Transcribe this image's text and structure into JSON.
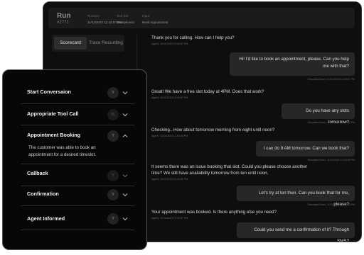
{
  "header": {
    "title": "Run",
    "run_id": "#2771",
    "fields": [
      {
        "label": "Runtime",
        "value": "11/11/2023 12:44:57 PM"
      },
      {
        "label": "Tool Set",
        "value": "Receptionist"
      },
      {
        "label": "Input",
        "value": "Book Appointment"
      }
    ]
  },
  "tabs": [
    {
      "label": "Scorecard",
      "active": true
    },
    {
      "label": "Trace Recording",
      "active": false
    }
  ],
  "transcript": {
    "agent": [
      {
        "text": "Thank you for calling. How can I help you?",
        "meta": "Agent | 11/11/2023 12:44:57 PM"
      },
      {
        "text": "Great! We have a free slot today at 4PM. Does that work?",
        "meta": "Agent | 11/11/2023 12:44:57 PM"
      },
      {
        "text": "Checking...How about tomorrow morning from eight until noon?",
        "meta": "Agent | 11/11/2023 12:44:44 PM"
      },
      {
        "text": "It seems there was an issue booking that slot. Could you please choose another time? We still have availability tomorrow from ten until noon.",
        "meta": "Agent | 11/11/2023 12:44:52 PM"
      },
      {
        "text": "Your appointment was booked. Is there anything else you need?",
        "meta": "Agent | 11/11/2023 12:44:57 PM"
      }
    ],
    "user": [
      {
        "text": "Hi! I'd like to book an appointment, please. Can you help me with that?",
        "meta": "Simulated User | 11/11/2023 12:44:57 PM"
      },
      {
        "text": "Do you have any slots tomorrow?",
        "meta": "Simulated User | 11/11/2023 12:44:12 PM"
      },
      {
        "text": "I can do 9 AM tomorrow. Can we book that?",
        "meta": "Simulated User | 11/11/2023 12:44:28 PM"
      },
      {
        "text": "Let's try at ten then. Can you book that for me, please?",
        "meta": "Simulated User | 11/11/2023 12:44:53 PM"
      },
      {
        "text": "Could you send me a confirmation of it? Through SMS?",
        "meta": ""
      }
    ]
  },
  "scorecard": {
    "items": [
      {
        "label": "Start Conversaion",
        "badge": "Y",
        "expanded": false
      },
      {
        "label": "Appropriate Tool Call",
        "badge": "YL",
        "expanded": false
      },
      {
        "label": "Appointment Booking",
        "badge": "Y",
        "expanded": true,
        "detail": "The customer was able to book an appointment for a desired timeslot."
      },
      {
        "label": "Callback",
        "badge": "Y",
        "expanded": false
      },
      {
        "label": "Confirmation",
        "badge": "Y",
        "expanded": false
      },
      {
        "label": "Agent Informed",
        "badge": "Y",
        "expanded": false
      }
    ]
  }
}
